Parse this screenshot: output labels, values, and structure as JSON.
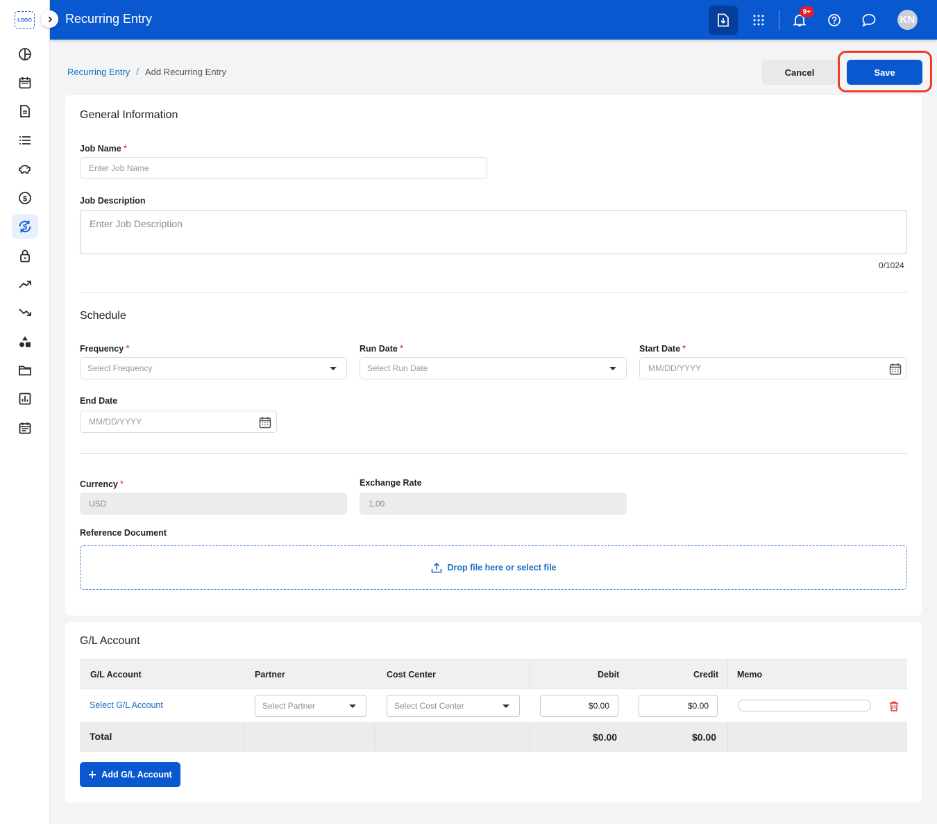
{
  "app": {
    "title": "Recurring Entry",
    "logo_text": "LOGO",
    "notification_count": "9+",
    "user_initials": "KN"
  },
  "sidebar": {
    "icons": [
      "dashboard-icon",
      "calendar-icon",
      "document-icon",
      "list-icon",
      "piggy-bank-icon",
      "dollar-icon",
      "recurring-dollar-icon",
      "lock-icon",
      "trending-up-icon",
      "trending-down-icon",
      "shapes-icon",
      "folder-icon",
      "report-chart-icon",
      "schedule-icon"
    ],
    "active": "recurring-dollar-icon"
  },
  "breadcrumb": {
    "parent": "Recurring Entry",
    "separator": "/",
    "current": "Add Recurring Entry"
  },
  "actions": {
    "cancel": "Cancel",
    "save": "Save"
  },
  "general": {
    "title": "General Information",
    "job_name_label": "Job Name",
    "job_name_placeholder": "Enter Job Name",
    "job_desc_label": "Job Description",
    "job_desc_placeholder": "Enter Job Description",
    "counter": "0/1024"
  },
  "schedule": {
    "title": "Schedule",
    "frequency_label": "Frequency",
    "frequency_placeholder": "Select Frequency",
    "run_date_label": "Run Date",
    "run_date_placeholder": "Select Run Date",
    "start_date_label": "Start Date",
    "start_date_placeholder": "MM/DD/YYYY",
    "end_date_label": "End Date",
    "end_date_placeholder": "MM/DD/YYYY"
  },
  "currency": {
    "currency_label": "Currency",
    "currency_value": "USD",
    "exchange_label": "Exchange Rate",
    "exchange_value": "1.00",
    "ref_doc_label": "Reference Document",
    "dropzone_text": "Drop file here or select file"
  },
  "gl": {
    "title": "G/L Account",
    "columns": [
      "G/L Account",
      "Partner",
      "Cost Center",
      "Debit",
      "Credit",
      "Memo"
    ],
    "row": {
      "account": "Select G/L Account",
      "partner": "Select Partner",
      "cost_center": "Select Cost Center",
      "debit": "$0.00",
      "credit": "$0.00",
      "memo": ""
    },
    "total": {
      "label": "Total",
      "debit": "$0.00",
      "credit": "$0.00"
    },
    "add_button": "Add G/L Account"
  },
  "colors": {
    "primary": "#0a58d0",
    "link": "#1a6dc8",
    "required": "#e02f2f",
    "highlight": "#f23a24"
  }
}
